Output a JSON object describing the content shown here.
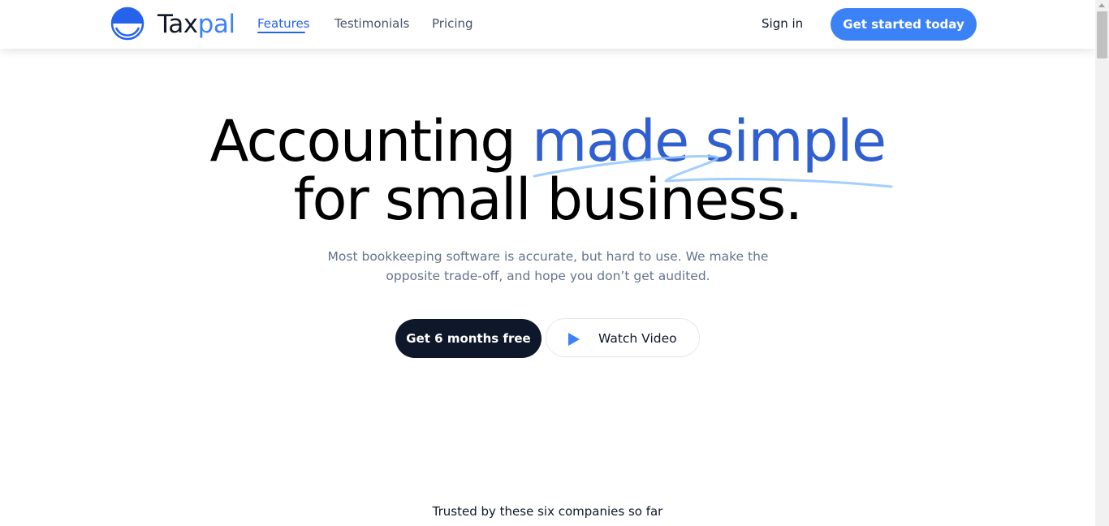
{
  "header": {
    "brand_part1": "Tax",
    "brand_part2": "pal",
    "logo_icon": "half-filled-circle-logo-icon",
    "nav": [
      {
        "label": "Features",
        "active": true
      },
      {
        "label": "Testimonials",
        "active": false
      },
      {
        "label": "Pricing",
        "active": false
      }
    ],
    "signin_label": "Sign in",
    "cta_label": "Get started today"
  },
  "hero": {
    "title_part1": "Accounting ",
    "title_highlight": "made simple",
    "title_part2": "for small business.",
    "subtitle": "Most bookkeeping software is accurate, but hard to use. We make the opposite trade-off, and hope you don’t get audited.",
    "primary_button": "Get 6 months free",
    "secondary_button": "Watch Video",
    "secondary_icon": "play-icon"
  },
  "trusted": {
    "text": "Trusted by these six companies so far"
  },
  "colors": {
    "accent": "#3b82f6",
    "highlight": "#2f5fd0",
    "dark": "#0f172a",
    "muted": "#64748b"
  }
}
